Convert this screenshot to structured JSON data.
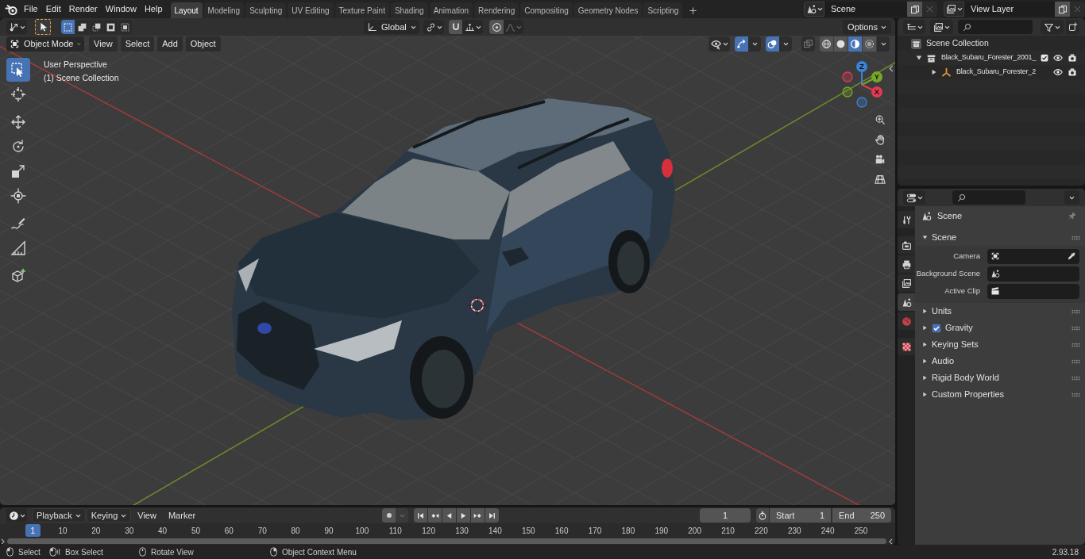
{
  "top_bar": {
    "menus": [
      "File",
      "Edit",
      "Render",
      "Window",
      "Help"
    ],
    "workspaces": [
      {
        "label": "Layout",
        "selected": true
      },
      {
        "label": "Modeling",
        "selected": false
      },
      {
        "label": "Sculpting",
        "selected": false
      },
      {
        "label": "UV Editing",
        "selected": false
      },
      {
        "label": "Texture Paint",
        "selected": false
      },
      {
        "label": "Shading",
        "selected": false
      },
      {
        "label": "Animation",
        "selected": false
      },
      {
        "label": "Rendering",
        "selected": false
      },
      {
        "label": "Compositing",
        "selected": false
      },
      {
        "label": "Geometry Nodes",
        "selected": false
      },
      {
        "label": "Scripting",
        "selected": false
      }
    ],
    "scene": "Scene",
    "view_layer": "View Layer"
  },
  "tool_header": {
    "select_modes": [
      {
        "kind": "set",
        "selected": true
      },
      {
        "kind": "extend",
        "selected": false
      },
      {
        "kind": "subtract",
        "selected": false
      },
      {
        "kind": "invert",
        "selected": false
      },
      {
        "kind": "intersect",
        "selected": false
      }
    ],
    "orientation": "Global",
    "snap": {
      "on": false
    },
    "proportional_editing": {
      "on": false
    },
    "options": "Options"
  },
  "viewport_header": {
    "mode": "Object Mode",
    "menus": [
      "View",
      "Select",
      "Add",
      "Object"
    ],
    "gizmos": {
      "on": true
    },
    "overlays": {
      "on": true
    },
    "xray": {
      "on": false
    },
    "shading_modes": [
      {
        "kind": "wireframe",
        "selected": false
      },
      {
        "kind": "solid",
        "selected": false
      },
      {
        "kind": "material",
        "selected": true
      },
      {
        "kind": "rendered",
        "selected": false
      }
    ]
  },
  "viewport": {
    "info": [
      "User Perspective",
      "(1) Scene Collection"
    ],
    "tool_groups": [
      [
        {
          "kind": "select_box",
          "selected": true
        },
        {
          "kind": "cursor",
          "selected": false
        }
      ],
      [
        {
          "kind": "move",
          "selected": false
        },
        {
          "kind": "rotate",
          "selected": false
        },
        {
          "kind": "scale",
          "selected": false
        },
        {
          "kind": "transform",
          "selected": false
        }
      ],
      [
        {
          "kind": "annotate",
          "selected": false
        },
        {
          "kind": "measure",
          "selected": false
        }
      ],
      [
        {
          "kind": "add_cube",
          "selected": false
        }
      ]
    ],
    "axes": [
      {
        "label": "Z",
        "color": "#3b82d9"
      },
      {
        "label": "Y",
        "color": "#76a72a"
      },
      {
        "label": "X",
        "color": "#e23a52"
      }
    ]
  },
  "outliner": {
    "tree": [
      {
        "kind": "scene_collection",
        "label": "Scene Collection",
        "children": [
          {
            "kind": "collection",
            "label": "Black_Subaru_Forester_2001_",
            "expanded": true,
            "checked": true,
            "visible": true,
            "renderable": true,
            "children": [
              {
                "kind": "empty",
                "label": "Black_Subaru_Forester_2",
                "expanded": false,
                "visible": true,
                "renderable": true
              }
            ]
          }
        ]
      }
    ]
  },
  "properties": {
    "tab_groups": [
      [
        {
          "kind": "tool",
          "selected": false
        }
      ],
      [
        {
          "kind": "render",
          "selected": false
        },
        {
          "kind": "output",
          "selected": false
        },
        {
          "kind": "view_layer",
          "selected": false
        },
        {
          "kind": "scene",
          "selected": true
        },
        {
          "kind": "world",
          "selected": false
        }
      ],
      [
        {
          "kind": "texture",
          "selected": false
        }
      ]
    ],
    "context": "Scene",
    "panels": [
      {
        "title": "Scene",
        "expanded": true,
        "fields": [
          {
            "kind": "object",
            "label": "Camera"
          },
          {
            "kind": "scene",
            "label": "Background Scene"
          },
          {
            "kind": "clip",
            "label": "Active Clip"
          }
        ]
      },
      {
        "title": "Units",
        "expanded": false
      },
      {
        "title": "Gravity",
        "expanded": false,
        "checked": true
      },
      {
        "title": "Keying Sets",
        "expanded": false
      },
      {
        "title": "Audio",
        "expanded": false
      },
      {
        "title": "Rigid Body World",
        "expanded": false
      },
      {
        "title": "Custom Properties",
        "expanded": false
      }
    ]
  },
  "timeline": {
    "menus": [
      {
        "kind": "dropdown",
        "label": "Playback"
      },
      {
        "kind": "dropdown",
        "label": "Keying"
      },
      {
        "kind": "menu",
        "label": "View"
      },
      {
        "kind": "menu",
        "label": "Marker"
      }
    ],
    "auto_keying": {
      "on": false
    },
    "current_frame": "1",
    "start": {
      "label": "Start",
      "value": "1"
    },
    "end": {
      "label": "End",
      "value": "250"
    },
    "playhead": "1",
    "ruler": [
      "10",
      "20",
      "30",
      "40",
      "50",
      "60",
      "70",
      "80",
      "90",
      "100",
      "110",
      "120",
      "130",
      "140",
      "150",
      "160",
      "170",
      "180",
      "190",
      "200",
      "210",
      "220",
      "230",
      "240",
      "250"
    ]
  },
  "status_bar": {
    "hints": [
      {
        "kind": "left_click",
        "label": "Select"
      },
      {
        "kind": "left_drag",
        "label": "Box Select"
      },
      {
        "kind": "middle_drag",
        "label": "Rotate View"
      },
      {
        "kind": "right_click",
        "label": "Object Context Menu"
      }
    ],
    "version": "2.93.18"
  }
}
